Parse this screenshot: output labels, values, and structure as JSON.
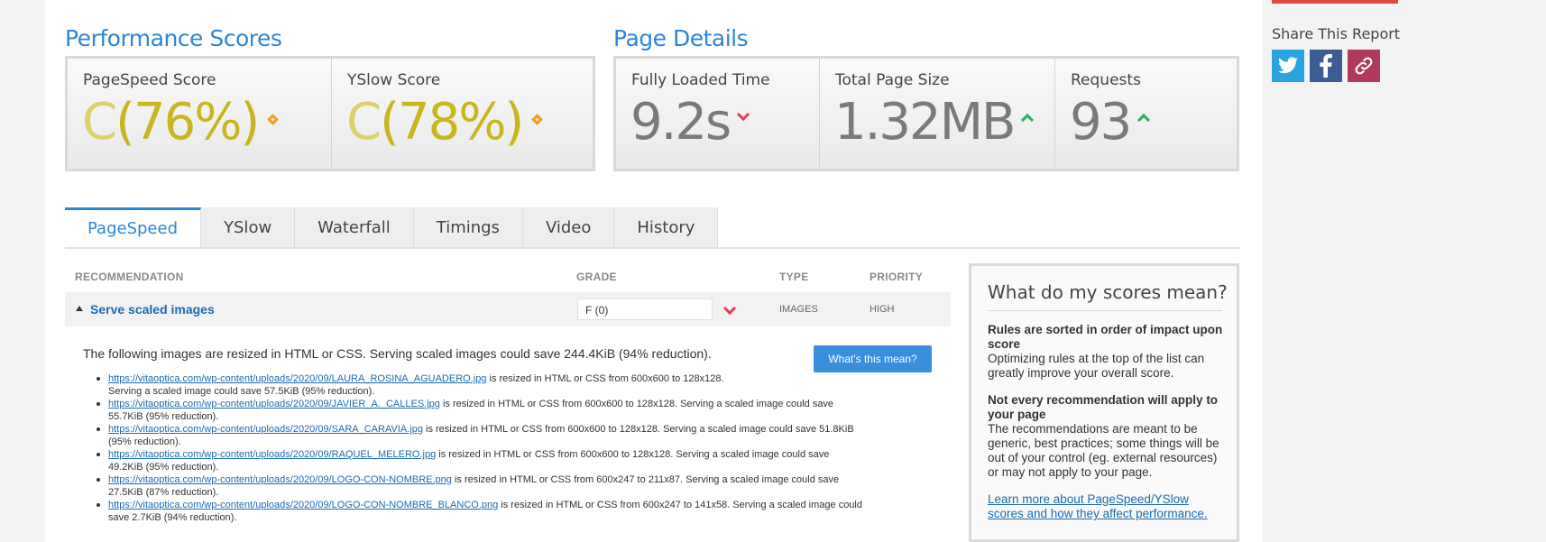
{
  "performance": {
    "title": "Performance Scores",
    "pagespeed": {
      "label": "PageSpeed Score",
      "grade": "C",
      "percent": "(76%)"
    },
    "yslow": {
      "label": "YSlow Score",
      "grade": "C",
      "percent": "(78%)"
    }
  },
  "details": {
    "title": "Page Details",
    "load_time": {
      "label": "Fully Loaded Time",
      "value": "9.2s",
      "trend": "down"
    },
    "page_size": {
      "label": "Total Page Size",
      "value": "1.32MB",
      "trend": "up"
    },
    "requests": {
      "label": "Requests",
      "value": "93",
      "trend": "up"
    }
  },
  "share": {
    "title": "Share This Report",
    "buttons": [
      {
        "icon": "twitter-icon",
        "color": "#2aa3e0"
      },
      {
        "icon": "facebook-icon",
        "color": "#3b5c94"
      },
      {
        "icon": "link-icon",
        "color": "#b03a5b"
      }
    ]
  },
  "tabs": [
    "PageSpeed",
    "YSlow",
    "Waterfall",
    "Timings",
    "Video",
    "History"
  ],
  "active_tab": "PageSpeed",
  "table": {
    "headers": {
      "recommendation": "RECOMMENDATION",
      "grade": "GRADE",
      "type": "TYPE",
      "priority": "PRIORITY"
    },
    "row": {
      "name": "Serve scaled images",
      "grade": "F (0)",
      "type": "IMAGES",
      "priority": "HIGH"
    }
  },
  "detail": {
    "intro": "The following images are resized in HTML or CSS. Serving scaled images could save 244.4KiB (94% reduction).",
    "button": "What's this mean?",
    "items": [
      {
        "url": "https://vitaoptica.com/wp-content/uploads/2020/09/LAURA_ROSINA_AGUADERO.jpg",
        "text": " is resized in HTML or CSS from 600x600 to 128x128.",
        "text2": "Serving a scaled image could save 57.5KiB (95% reduction)."
      },
      {
        "url": "https://vitaoptica.com/wp-content/uploads/2020/09/JAVIER_A._CALLES.jpg",
        "text": " is resized in HTML or CSS from 600x600 to 128x128. Serving a scaled image could save",
        "text2": "55.7KiB (95% reduction)."
      },
      {
        "url": "https://vitaoptica.com/wp-content/uploads/2020/09/SARA_CARAVIA.jpg",
        "text": " is resized in HTML or CSS from 600x600 to 128x128. Serving a scaled image could save 51.8KiB",
        "text2": "(95% reduction)."
      },
      {
        "url": "https://vitaoptica.com/wp-content/uploads/2020/09/RAQUEL_MELERO.jpg",
        "text": " is resized in HTML or CSS from 600x600 to 128x128. Serving a scaled image could save",
        "text2": "49.2KiB (95% reduction)."
      },
      {
        "url": "https://vitaoptica.com/wp-content/uploads/2020/09/LOGO-CON-NOMBRE.png",
        "text": " is resized in HTML or CSS from 600x247 to 211x87. Serving a scaled image could save",
        "text2": "27.5KiB (87% reduction)."
      },
      {
        "url": "https://vitaoptica.com/wp-content/uploads/2020/09/LOGO-CON-NOMBRE_BLANCO.png",
        "text": " is resized in HTML or CSS from 600x247 to 141x58. Serving a scaled image could",
        "text2": "save 2.7KiB (94% reduction)."
      }
    ]
  },
  "scores_help": {
    "title": "What do my scores mean?",
    "p1_head": "Rules are sorted in order of impact upon score",
    "p1_body": "Optimizing rules at the top of the list can greatly improve your overall score.",
    "p2_head": "Not every recommendation will apply to your page",
    "p2_body": "The recommendations are meant to be generic, best practices; some things will be out of your control (eg. external resources) or may not apply to your page.",
    "link": "Learn more about PageSpeed/YSlow scores and how they affect performance."
  }
}
